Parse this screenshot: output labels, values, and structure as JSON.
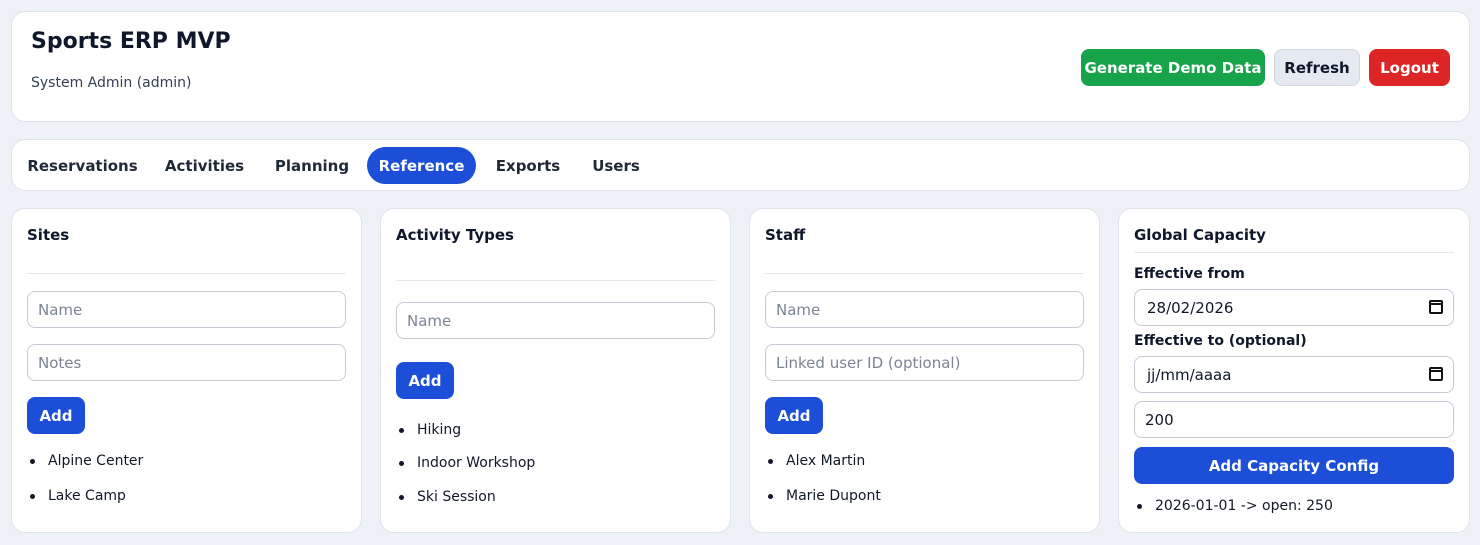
{
  "header": {
    "title": "Sports ERP MVP",
    "subtitle": "System Admin (admin)",
    "buttons": {
      "generate": "Generate Demo Data",
      "refresh": "Refresh",
      "logout": "Logout"
    }
  },
  "tabs": [
    {
      "label": "Reservations"
    },
    {
      "label": "Activities"
    },
    {
      "label": "Planning"
    },
    {
      "label": "Reference",
      "active": true
    },
    {
      "label": "Exports"
    },
    {
      "label": "Users"
    }
  ],
  "sites": {
    "title": "Sites",
    "name_placeholder": "Name",
    "notes_placeholder": "Notes",
    "add_label": "Add",
    "items": [
      "Alpine Center",
      "Lake Camp"
    ]
  },
  "activity_types": {
    "title": "Activity Types",
    "name_placeholder": "Name",
    "add_label": "Add",
    "items": [
      "Hiking",
      "Indoor Workshop",
      "Ski Session"
    ]
  },
  "staff": {
    "title": "Staff",
    "name_placeholder": "Name",
    "user_placeholder": "Linked user ID (optional)",
    "add_label": "Add",
    "items": [
      "Alex Martin",
      "Marie Dupont"
    ]
  },
  "capacity": {
    "title": "Global Capacity",
    "from_label": "Effective from",
    "from_value": "28/02/2026",
    "to_label": "Effective to (optional)",
    "to_value": "jj/mm/aaaa",
    "capacity_value": "200",
    "add_label": "Add Capacity Config",
    "items": [
      "2026-01-01 -> open: 250"
    ]
  },
  "colors": {
    "primary": "#1d4ed8",
    "success": "#16a34a",
    "danger": "#dc2626"
  }
}
